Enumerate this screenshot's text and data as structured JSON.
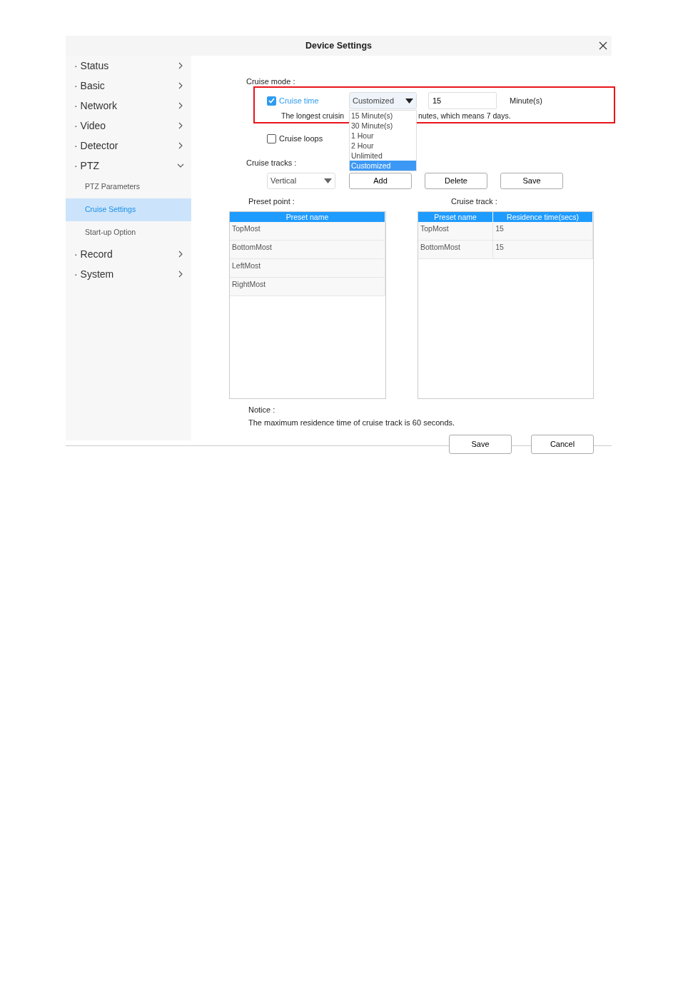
{
  "window": {
    "title": "Device Settings"
  },
  "sidebar": {
    "items": [
      {
        "label": "· Status",
        "expanded": false
      },
      {
        "label": "· Basic",
        "expanded": false
      },
      {
        "label": "· Network",
        "expanded": false
      },
      {
        "label": "· Video",
        "expanded": false
      },
      {
        "label": "· Detector",
        "expanded": false
      },
      {
        "label": "· PTZ",
        "expanded": true,
        "children": [
          {
            "label": "PTZ Parameters",
            "selected": false
          },
          {
            "label": "Cruise Settings",
            "selected": true
          },
          {
            "label": "Start-up Option",
            "selected": false
          }
        ]
      },
      {
        "label": "· Record",
        "expanded": false
      },
      {
        "label": "· System",
        "expanded": false
      }
    ]
  },
  "cruise_mode": {
    "label": "Cruise mode :",
    "highlighted": true,
    "cruise_time": {
      "label": "Cruise time",
      "checked": true
    },
    "duration_select": {
      "value": "Customized",
      "expanded": true,
      "options": [
        {
          "label": "15 Minute(s)",
          "selected": false
        },
        {
          "label": "30 Minute(s)",
          "selected": false
        },
        {
          "label": "1 Hour",
          "selected": false
        },
        {
          "label": "2 Hour",
          "selected": false
        },
        {
          "label": "Unlimited",
          "selected": false
        },
        {
          "label": "Customized",
          "selected": true
        }
      ]
    },
    "minutes_input": {
      "value": "15"
    },
    "unit": "Minute(s)",
    "hint_start": "The longest cruisin",
    "hint_end": "nutes, which means 7 days."
  },
  "cruise_loops": {
    "label": "Cruise loops",
    "checked": false
  },
  "cruise_tracks": {
    "label": "Cruise tracks :",
    "track_select": {
      "value": "Vertical"
    },
    "buttons": [
      "Add",
      "Delete",
      "Save"
    ]
  },
  "preset_point": {
    "label": "Preset point :",
    "columns": [
      "Preset name"
    ],
    "rows": [
      [
        "TopMost"
      ],
      [
        "BottomMost"
      ],
      [
        "LeftMost"
      ],
      [
        "RightMost"
      ]
    ]
  },
  "cruise_track": {
    "label": "Cruise track :",
    "columns": [
      "Preset name",
      "Residence time(secs)"
    ],
    "rows": [
      [
        "TopMost",
        "15"
      ],
      [
        "BottomMost",
        "15"
      ]
    ]
  },
  "notice": {
    "label": "Notice :",
    "text": "The maximum residence time of cruise track is 60 seconds."
  },
  "footer_buttons": [
    "Save",
    "Cancel"
  ]
}
